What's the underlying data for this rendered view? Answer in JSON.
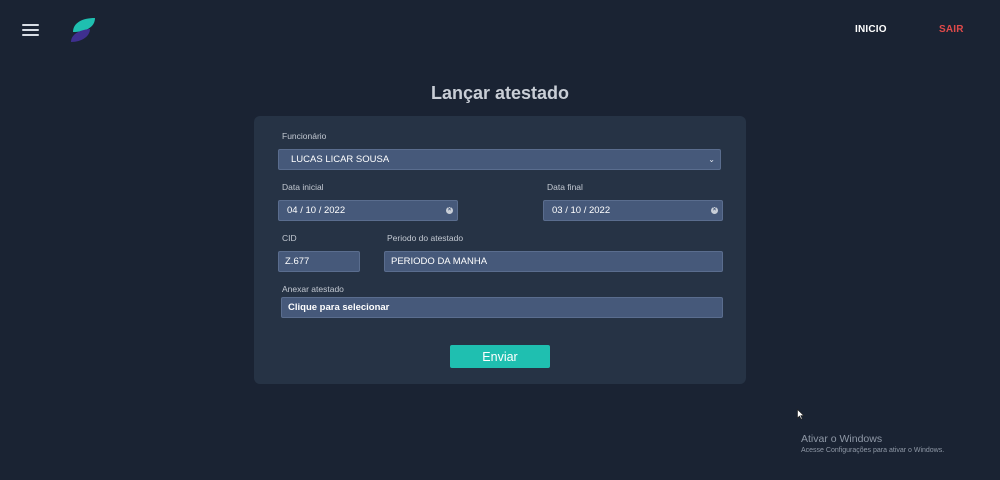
{
  "header": {
    "nav": {
      "inicio": "INICIO",
      "sair": "SAIR"
    },
    "colors": {
      "sair": "#e04a4a",
      "accent": "#1fbfb0"
    }
  },
  "page": {
    "title": "Lançar atestado"
  },
  "form": {
    "funcionario": {
      "label": "Funcionário",
      "value": "LUCAS LICAR SOUSA"
    },
    "data_inicial": {
      "label": "Data inicial",
      "value": "04 / 10 / 2022"
    },
    "data_final": {
      "label": "Data final",
      "value": "03 / 10 / 2022"
    },
    "cid": {
      "label": "CID",
      "value": "Z.677"
    },
    "periodo": {
      "label": "Periodo do atestado",
      "value": "PERIODO DA MANHA"
    },
    "anexo": {
      "label": "Anexar atestado",
      "value": "Clique para selecionar"
    },
    "submit_label": "Enviar"
  },
  "watermark": {
    "line1": "Ativar o Windows",
    "line2": "Acesse Configurações para ativar o Windows."
  }
}
